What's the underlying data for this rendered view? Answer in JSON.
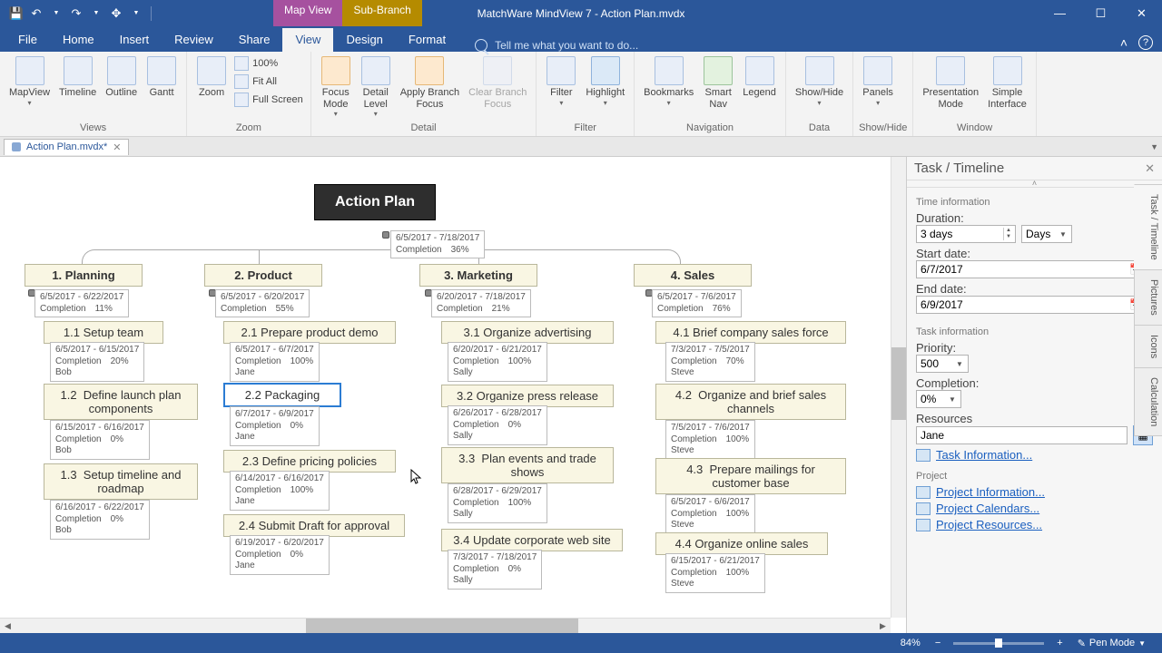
{
  "titlebar": {
    "title": "MatchWare MindView 7 - Action Plan.mvdx"
  },
  "context_tabs": {
    "map_view": "Map View",
    "sub_branch": "Sub-Branch"
  },
  "menu": {
    "file": "File",
    "home": "Home",
    "insert": "Insert",
    "review": "Review",
    "share": "Share",
    "view": "View",
    "design": "Design",
    "format": "Format",
    "tellme": "Tell me what you want to do..."
  },
  "ribbon": {
    "views": {
      "label": "Views",
      "mapview": "MapView",
      "timeline": "Timeline",
      "outline": "Outline",
      "gantt": "Gantt"
    },
    "zoom": {
      "label": "Zoom",
      "zoom": "Zoom",
      "pct": "100%",
      "fitall": "Fit All",
      "fullscreen": "Full Screen"
    },
    "detail": {
      "label": "Detail",
      "focus": "Focus\nMode",
      "detaillvl": "Detail\nLevel",
      "applybranch": "Apply Branch\nFocus",
      "clearbranch": "Clear Branch\nFocus"
    },
    "filter": {
      "label": "Filter",
      "filter": "Filter",
      "highlight": "Highlight"
    },
    "nav": {
      "label": "Navigation",
      "bookmarks": "Bookmarks",
      "smartnav": "Smart\nNav",
      "legend": "Legend"
    },
    "data": {
      "label": "Data",
      "showhide": "Show/Hide"
    },
    "showhide": {
      "label": "Show/Hide",
      "panels": "Panels"
    },
    "window": {
      "label": "Window",
      "presentation": "Presentation\nMode",
      "simple": "Simple\nInterface"
    }
  },
  "doctab": {
    "name": "Action Plan.mvdx*"
  },
  "map": {
    "root": {
      "title": "Action Plan",
      "dates": "6/5/2017 - 7/18/2017",
      "completion_label": "Completion",
      "completion": "36%"
    },
    "cols": [
      {
        "title": "1.  Planning",
        "dates": "6/5/2017 - 6/22/2017",
        "compl_lbl": "Completion",
        "compl": "11%",
        "items": [
          {
            "title": "1.1  Setup team",
            "dates": "6/5/2017 - 6/15/2017",
            "compl": "20%",
            "res": "Bob"
          },
          {
            "title": "1.2  Define launch plan\ncomponents",
            "dates": "6/15/2017 - 6/16/2017",
            "compl": "0%",
            "res": "Bob"
          },
          {
            "title": "1.3  Setup timeline and\nroadmap",
            "dates": "6/16/2017 - 6/22/2017",
            "compl": "0%",
            "res": "Bob"
          }
        ]
      },
      {
        "title": "2.  Product",
        "dates": "6/5/2017 - 6/20/2017",
        "compl_lbl": "Completion",
        "compl": "55%",
        "items": [
          {
            "title": "2.1  Prepare product demo",
            "dates": "6/5/2017 - 6/7/2017",
            "compl": "100%",
            "res": "Jane"
          },
          {
            "title": "2.2  Packaging",
            "dates": "6/7/2017 - 6/9/2017",
            "compl": "0%",
            "res": "Jane",
            "selected": true
          },
          {
            "title": "2.3  Define pricing policies",
            "dates": "6/14/2017 - 6/16/2017",
            "compl": "100%",
            "res": "Jane"
          },
          {
            "title": "2.4  Submit Draft for approval",
            "dates": "6/19/2017 - 6/20/2017",
            "compl": "0%",
            "res": "Jane"
          }
        ]
      },
      {
        "title": "3.  Marketing",
        "dates": "6/20/2017 - 7/18/2017",
        "compl_lbl": "Completion",
        "compl": "21%",
        "items": [
          {
            "title": "3.1  Organize advertising",
            "dates": "6/20/2017 - 6/21/2017",
            "compl": "100%",
            "res": "Sally"
          },
          {
            "title": "3.2  Organize press release",
            "dates": "6/26/2017 - 6/28/2017",
            "compl": "0%",
            "res": "Sally"
          },
          {
            "title": "3.3  Plan events and trade\nshows",
            "dates": "6/28/2017 - 6/29/2017",
            "compl": "100%",
            "res": "Sally"
          },
          {
            "title": "3.4  Update corporate web site",
            "dates": "7/3/2017 - 7/18/2017",
            "compl": "0%",
            "res": "Sally"
          }
        ]
      },
      {
        "title": "4.  Sales",
        "dates": "6/5/2017 - 7/6/2017",
        "compl_lbl": "Completion",
        "compl": "76%",
        "items": [
          {
            "title": "4.1  Brief company sales force",
            "dates": "7/3/2017 - 7/5/2017",
            "compl": "70%",
            "res": "Steve"
          },
          {
            "title": "4.2  Organize and brief sales\nchannels",
            "dates": "7/5/2017 - 7/6/2017",
            "compl": "100%",
            "res": "Steve"
          },
          {
            "title": "4.3  Prepare mailings for\ncustomer base",
            "dates": "6/5/2017 - 6/6/2017",
            "compl": "100%",
            "res": "Steve"
          },
          {
            "title": "4.4  Organize online sales",
            "dates": "6/15/2017 - 6/21/2017",
            "compl": "100%",
            "res": "Steve"
          }
        ]
      }
    ]
  },
  "sidepanel": {
    "title": "Task / Timeline",
    "time_info": "Time information",
    "duration_lbl": "Duration:",
    "duration_val": "3 days",
    "duration_unit": "Days",
    "start_lbl": "Start date:",
    "start_val": "6/7/2017",
    "end_lbl": "End date:",
    "end_val": "6/9/2017",
    "task_info": "Task information",
    "priority_lbl": "Priority:",
    "priority_val": "500",
    "completion_lbl": "Completion:",
    "completion_val": "0%",
    "resources_lbl": "Resources",
    "resources_val": "Jane",
    "task_info_link": "Task Information...",
    "project_lbl": "Project",
    "project_info": "Project Information...",
    "project_cal": "Project Calendars...",
    "project_res": "Project Resources..."
  },
  "side_tabs": {
    "t1": "Task / Timeline",
    "t2": "Pictures",
    "t3": "Icons",
    "t4": "Calculation"
  },
  "statusbar": {
    "zoom": "84%",
    "penmode": "Pen Mode"
  }
}
